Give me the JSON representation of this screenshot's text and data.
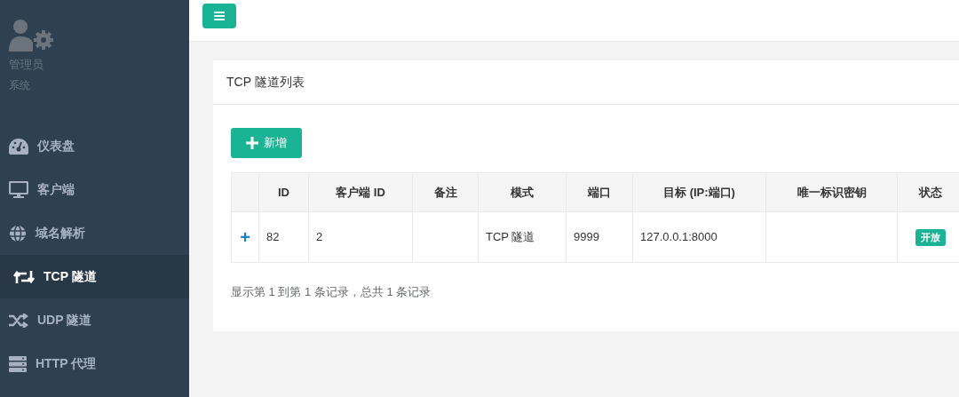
{
  "sidebar": {
    "user": {
      "name": "管理员",
      "role": "系统"
    },
    "items": [
      {
        "label": "仪表盘",
        "selected": false
      },
      {
        "label": "客户端",
        "selected": false
      },
      {
        "label": "域名解析",
        "selected": false
      },
      {
        "label": "TCP 隧道",
        "selected": true
      },
      {
        "label": "UDP 隧道",
        "selected": false
      },
      {
        "label": "HTTP 代理",
        "selected": false
      }
    ]
  },
  "panel": {
    "title": "TCP 隧道列表",
    "add_button": "新增",
    "table": {
      "columns": [
        "",
        "ID",
        "客户端 ID",
        "备注",
        "模式",
        "端口",
        "目标 (IP:端口)",
        "唯一标识密钥",
        "状态"
      ],
      "rows": [
        {
          "cells": [
            {
              "kind": "expand",
              "text": "+"
            },
            {
              "kind": "text",
              "text": "82"
            },
            {
              "kind": "text",
              "text": "2"
            },
            {
              "kind": "text",
              "text": ""
            },
            {
              "kind": "text",
              "text": "TCP 隧道"
            },
            {
              "kind": "text",
              "text": "9999"
            },
            {
              "kind": "text",
              "text": "127.0.0.1:8000"
            },
            {
              "kind": "text",
              "text": ""
            },
            {
              "kind": "badge",
              "text": "开放"
            }
          ]
        }
      ]
    },
    "footer": "显示第 1 到第 1 条记录，总共 1 条记录"
  }
}
